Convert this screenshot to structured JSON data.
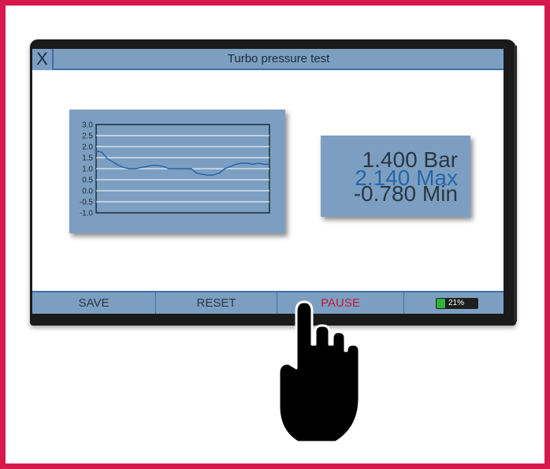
{
  "window": {
    "close_label": "X",
    "title": "Turbo pressure test"
  },
  "chart_data": {
    "type": "line",
    "ylim": [
      -1.0,
      3.0
    ],
    "y_ticks": [
      "3.0",
      "2.5",
      "2.0",
      "1.5",
      "1.0",
      "0.5",
      "0.0",
      "-0.5",
      "-1.0"
    ],
    "grid": true,
    "series": [
      {
        "values": [
          1.8,
          1.75,
          1.45,
          1.3,
          1.15,
          1.05,
          1.0,
          1.0,
          1.05,
          1.1,
          1.15,
          1.15,
          1.1,
          1.0,
          1.0,
          1.0,
          1.0,
          1.0,
          0.8,
          0.75,
          0.7,
          0.72,
          0.8,
          1.0,
          1.1,
          1.2,
          1.25,
          1.25,
          1.2,
          1.25,
          1.2,
          1.2
        ]
      }
    ]
  },
  "readout": {
    "current": "1.400 Bar",
    "max": "2.140 Max",
    "min": "-0.780 Min"
  },
  "toolbar": {
    "save_label": "SAVE",
    "reset_label": "RESET",
    "pause_label": "PAUSE",
    "battery_label": "21%",
    "battery_level": 0.21
  },
  "colors": {
    "frame": "#d6184c",
    "panel": "#7c9fc1",
    "pause_text": "#c1193f",
    "max_text": "#2566a8",
    "battery": "#2fb43a"
  },
  "icons": {
    "cursor": "pointing-hand-icon"
  }
}
